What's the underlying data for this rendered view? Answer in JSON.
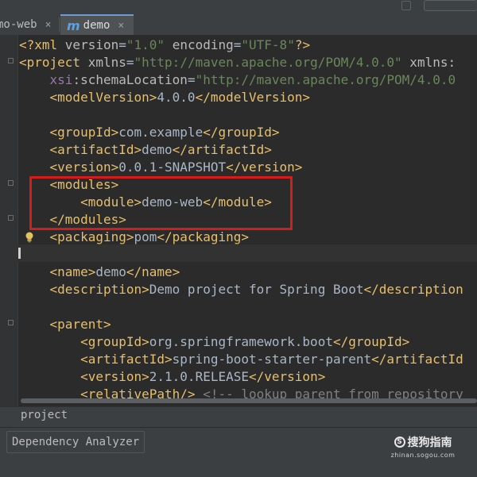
{
  "tabs": [
    {
      "label": "mo-web",
      "close": "×"
    },
    {
      "label": "demo",
      "close": "×",
      "icon": "maven-m-icon",
      "icon_glyph": "m"
    }
  ],
  "top_right": {
    "icon": "status-icon"
  },
  "code_lines": [
    [
      {
        "t": "<?xml ",
        "c": "tag"
      },
      {
        "t": "version",
        "c": "attr"
      },
      {
        "t": "=",
        "c": "txt"
      },
      {
        "t": "\"1.0\"",
        "c": "val"
      },
      {
        "t": " ",
        "c": "txt"
      },
      {
        "t": "encoding",
        "c": "attr"
      },
      {
        "t": "=",
        "c": "txt"
      },
      {
        "t": "\"UTF-8\"",
        "c": "val"
      },
      {
        "t": "?>",
        "c": "tag"
      }
    ],
    [
      {
        "t": "<project ",
        "c": "tag"
      },
      {
        "t": "xmlns",
        "c": "attr"
      },
      {
        "t": "=",
        "c": "txt"
      },
      {
        "t": "\"http://maven.apache.org/POM/4.0.0\"",
        "c": "val"
      },
      {
        "t": " xmlns:",
        "c": "attr"
      }
    ],
    [
      {
        "t": "    ",
        "c": "txt"
      },
      {
        "t": "xsi",
        "c": "ns"
      },
      {
        "t": ":schemaLocation",
        "c": "attr"
      },
      {
        "t": "=",
        "c": "txt"
      },
      {
        "t": "\"http://maven.apache.org/POM/4.0.0",
        "c": "val"
      }
    ],
    [
      {
        "t": "    ",
        "c": "txt"
      },
      {
        "t": "<modelVersion>",
        "c": "tag"
      },
      {
        "t": "4.0.0",
        "c": "txt"
      },
      {
        "t": "</modelVersion>",
        "c": "tag"
      }
    ],
    [],
    [
      {
        "t": "    ",
        "c": "txt"
      },
      {
        "t": "<groupId>",
        "c": "tag"
      },
      {
        "t": "com.example",
        "c": "txt"
      },
      {
        "t": "</groupId>",
        "c": "tag"
      }
    ],
    [
      {
        "t": "    ",
        "c": "txt"
      },
      {
        "t": "<artifactId>",
        "c": "tag"
      },
      {
        "t": "demo",
        "c": "txt"
      },
      {
        "t": "</artifactId>",
        "c": "tag"
      }
    ],
    [
      {
        "t": "    ",
        "c": "txt"
      },
      {
        "t": "<version>",
        "c": "tag"
      },
      {
        "t": "0.0.1-SNAPSHOT",
        "c": "txt"
      },
      {
        "t": "</version>",
        "c": "tag"
      }
    ],
    [
      {
        "t": "    ",
        "c": "txt"
      },
      {
        "t": "<modules>",
        "c": "tag"
      }
    ],
    [
      {
        "t": "        ",
        "c": "txt"
      },
      {
        "t": "<module>",
        "c": "tag"
      },
      {
        "t": "demo-web",
        "c": "txt"
      },
      {
        "t": "</module>",
        "c": "tag"
      }
    ],
    [
      {
        "t": "    ",
        "c": "txt"
      },
      {
        "t": "</modules>",
        "c": "tag"
      }
    ],
    [
      {
        "t": "    ",
        "c": "txt"
      },
      {
        "t": "<packaging>",
        "c": "tag"
      },
      {
        "t": "pom",
        "c": "txt"
      },
      {
        "t": "</packaging>",
        "c": "tag"
      }
    ],
    [],
    [
      {
        "t": "    ",
        "c": "txt"
      },
      {
        "t": "<name>",
        "c": "tag"
      },
      {
        "t": "demo",
        "c": "txt"
      },
      {
        "t": "</name>",
        "c": "tag"
      }
    ],
    [
      {
        "t": "    ",
        "c": "txt"
      },
      {
        "t": "<description>",
        "c": "tag"
      },
      {
        "t": "Demo project for Spring Boot",
        "c": "txt"
      },
      {
        "t": "</description",
        "c": "tag"
      }
    ],
    [],
    [
      {
        "t": "    ",
        "c": "txt"
      },
      {
        "t": "<parent>",
        "c": "tag"
      }
    ],
    [
      {
        "t": "        ",
        "c": "txt"
      },
      {
        "t": "<groupId>",
        "c": "tag"
      },
      {
        "t": "org.springframework.boot",
        "c": "txt"
      },
      {
        "t": "</groupId>",
        "c": "tag"
      }
    ],
    [
      {
        "t": "        ",
        "c": "txt"
      },
      {
        "t": "<artifactId>",
        "c": "tag"
      },
      {
        "t": "spring-boot-starter-parent",
        "c": "txt"
      },
      {
        "t": "</artifactId",
        "c": "tag"
      }
    ],
    [
      {
        "t": "        ",
        "c": "txt"
      },
      {
        "t": "<version>",
        "c": "tag"
      },
      {
        "t": "2.1.0.RELEASE",
        "c": "txt"
      },
      {
        "t": "</version>",
        "c": "tag"
      }
    ],
    [
      {
        "t": "        ",
        "c": "txt"
      },
      {
        "t": "<relativePath/>",
        "c": "tag"
      },
      {
        "t": " ",
        "c": "txt"
      },
      {
        "t": "<!-- lookup parent from repository",
        "c": "cmt"
      }
    ]
  ],
  "breadcrumb": "project",
  "bottom_tab": "Dependency Analyzer",
  "watermark": {
    "logo_text": "搜狗指南",
    "domain": "zhinan.sogou.com",
    "icon": "sogou-logo-icon",
    "icon_glyph": "S"
  },
  "colors": {
    "background": "#2b2b2b",
    "tag": "#e8bf6a",
    "attribute": "#bababa",
    "string": "#6a8759",
    "namespace": "#9876aa",
    "text": "#a9b7c6",
    "comment": "#808080",
    "highlight_box": "#d51c1c",
    "active_tab_accent": "#6c9bd2"
  }
}
